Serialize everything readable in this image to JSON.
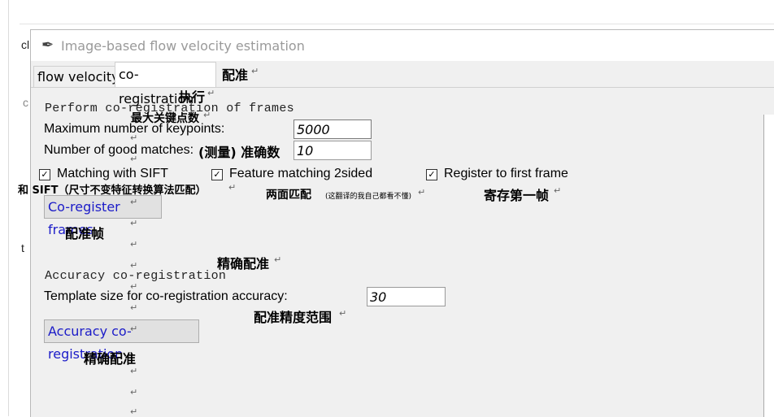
{
  "background": {
    "frag_top": "cl",
    "frag_mid": "c",
    "frag_low": "t"
  },
  "window": {
    "title": "Image-based flow velocity estimation",
    "icon": "feather-icon",
    "tabs": [
      {
        "label": "flow velocity",
        "active": false
      },
      {
        "label": "co-registration",
        "active": true
      }
    ]
  },
  "coreg": {
    "heading": "Perform co-registration of frames",
    "max_keypoints_label": "Maximum number of keypoints:",
    "max_keypoints_value": "5000",
    "good_matches_label": "Number of good matches:",
    "good_matches_value": "10",
    "checkboxes": [
      {
        "label": "Matching with SIFT",
        "checked": true
      },
      {
        "label": "Feature matching 2sided",
        "checked": true
      },
      {
        "label": "Register to first frame",
        "checked": true
      }
    ],
    "button_label": "Co-register frames"
  },
  "accuracy": {
    "heading": "Accuracy co-registration",
    "template_label": "Template size for co-registration accuracy:",
    "template_value": "30",
    "button_label": "Accuracy co-registration"
  },
  "annotations": {
    "tab_note": "配准",
    "execute": "执行",
    "max_kp": "最大关键点数",
    "good_matches": "(测量) 准确数",
    "sift": "和 SIFT（尺寸不变特征转换算法匹配）",
    "two_sided": "两面匹配",
    "two_sided_small": "(这翻译的我自己都看不懂)",
    "register_first": "寄存第一帧",
    "coreg_frames": "配准帧",
    "precise": "精确配准",
    "precision_range": "配准精度范围",
    "precise_btn": "精确配准",
    "return_mark": "↵"
  }
}
